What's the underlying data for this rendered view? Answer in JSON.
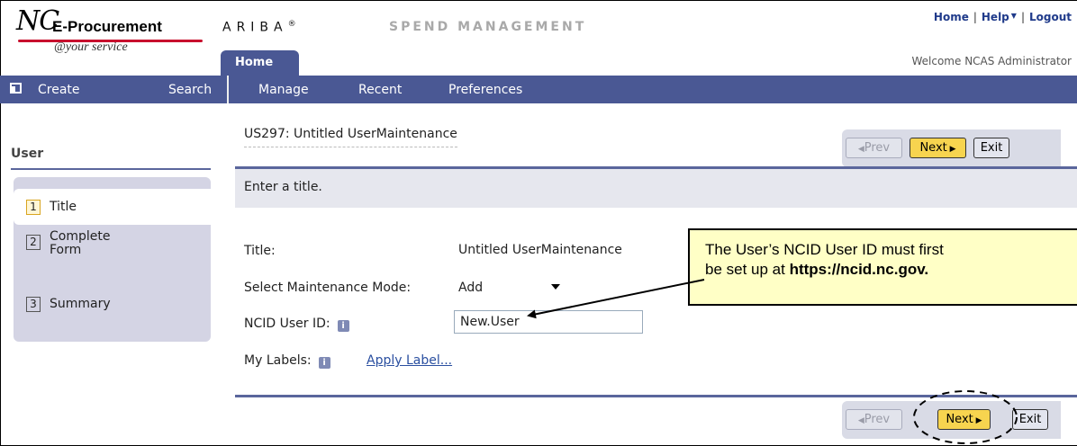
{
  "header": {
    "logo": {
      "nc": "NC",
      "name": "E-Procurement",
      "tagline": "@your service"
    },
    "ariba": "ARIBA",
    "ariba_mark": "®",
    "product": "SPEND MANAGEMENT",
    "links": {
      "home": "Home",
      "help": "Help",
      "logout": "Logout"
    },
    "welcome": "Welcome NCAS Administrator",
    "home_tab": "Home"
  },
  "nav": {
    "items": [
      "Create",
      "Search",
      "Manage",
      "Recent",
      "Preferences"
    ]
  },
  "sidebar": {
    "title": "User",
    "steps": [
      {
        "num": "1",
        "label": "Title",
        "active": true
      },
      {
        "num": "2",
        "label_line1": "Complete",
        "label_line2": "Form"
      },
      {
        "num": "3",
        "label": "Summary"
      }
    ]
  },
  "main": {
    "doc_title": "US297: Untitled UserMaintenance",
    "buttons": {
      "prev": "Prev",
      "next": "Next",
      "exit": "Exit"
    },
    "instruction": "Enter a title.",
    "fields": {
      "title_label": "Title:",
      "title_value": "Untitled UserMaintenance",
      "mode_label": "Select Maintenance Mode:",
      "mode_value": "Add",
      "ncid_label": "NCID User ID:",
      "ncid_value": "New.User",
      "labels_label": "My Labels:",
      "apply_label": "Apply Label..."
    }
  },
  "callout": {
    "line1": "The User’s NCID User ID must first",
    "line2_prefix": "be set up at ",
    "line2_link": "https://ncid.nc.gov."
  },
  "colors": {
    "nav_bg": "#4a5894",
    "next_button": "#f7d44f",
    "callout_bg": "#ffffc6",
    "sidebar_panel": "#d4d4e4"
  }
}
